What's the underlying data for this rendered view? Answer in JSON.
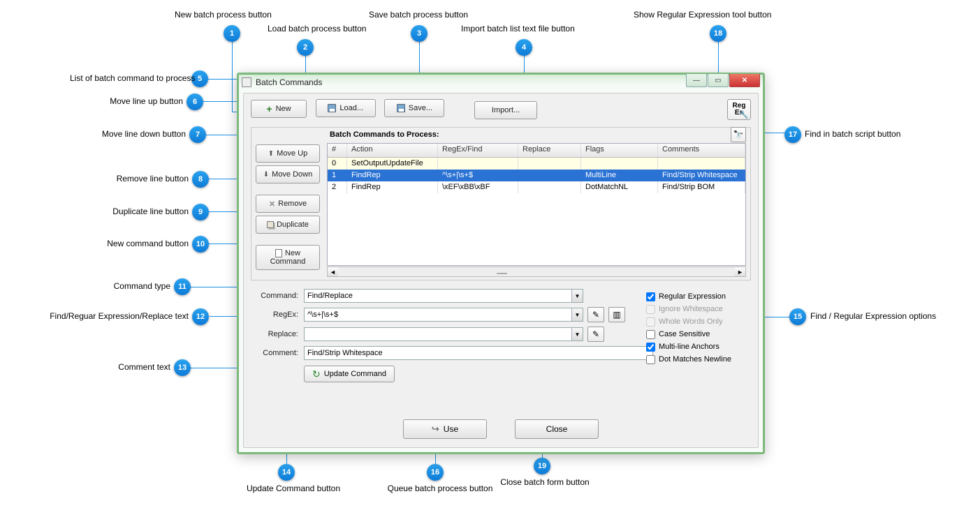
{
  "window": {
    "title": "Batch Commands"
  },
  "toolbar": {
    "new": "New",
    "load": "Load...",
    "save": "Save...",
    "import": "Import...",
    "regex_label_line1": "Reg",
    "regex_label_line2": "Ex"
  },
  "panel": {
    "heading": "Batch Commands to Process:",
    "move_up": "Move Up",
    "move_down": "Move Down",
    "remove": "Remove",
    "duplicate": "Duplicate",
    "new_command_line1": "New",
    "new_command_line2": "Command"
  },
  "grid": {
    "columns": {
      "num": "#",
      "action": "Action",
      "regex": "RegEx/Find",
      "replace": "Replace",
      "flags": "Flags",
      "comments": "Comments"
    },
    "rows": [
      {
        "num": "0",
        "action": "SetOutputUpdateFile",
        "regex": "",
        "replace": "",
        "flags": "",
        "comments": ""
      },
      {
        "num": "1",
        "action": "FindRep",
        "regex": "^\\s+|\\s+$",
        "replace": "",
        "flags": "MultiLine",
        "comments": "Find/Strip Whitespace"
      },
      {
        "num": "2",
        "action": "FindRep",
        "regex": "\\xEF\\xBB\\xBF",
        "replace": "",
        "flags": "DotMatchNL",
        "comments": "Find/Strip BOM"
      }
    ]
  },
  "form": {
    "command_label": "Command:",
    "command_value": "Find/Replace",
    "regex_label": "RegEx:",
    "regex_value": "^\\s+|\\s+$",
    "replace_label": "Replace:",
    "replace_value": "",
    "comment_label": "Comment:",
    "comment_value": "Find/Strip Whitespace",
    "update": "Update Command"
  },
  "options": {
    "regular_expression": "Regular Expression",
    "ignore_whitespace": "Ignore Whitespace",
    "whole_words": "Whole Words Only",
    "case_sensitive": "Case Sensitive",
    "multiline": "Multi-line Anchors",
    "dot_matches": "Dot Matches Newline"
  },
  "bottom": {
    "use": "Use",
    "close": "Close"
  },
  "callouts": {
    "1": "New batch process button",
    "2": "Load batch process button",
    "3": "Save batch process button",
    "4": "Import batch list text file button",
    "5": "List of batch command to process",
    "6": "Move line up button",
    "7": "Move line down button",
    "8": "Remove line button",
    "9": "Duplicate line button",
    "10": "New command button",
    "11": "Command type",
    "12": "Find/Reguar Expression/Replace text",
    "13": "Comment text",
    "14": "Update Command button",
    "15": "Find / Regular Expression options",
    "16": "Queue batch process button",
    "17": "Find in batch script button",
    "18": "Show Regular Expression tool button",
    "19": "Close batch form button"
  }
}
